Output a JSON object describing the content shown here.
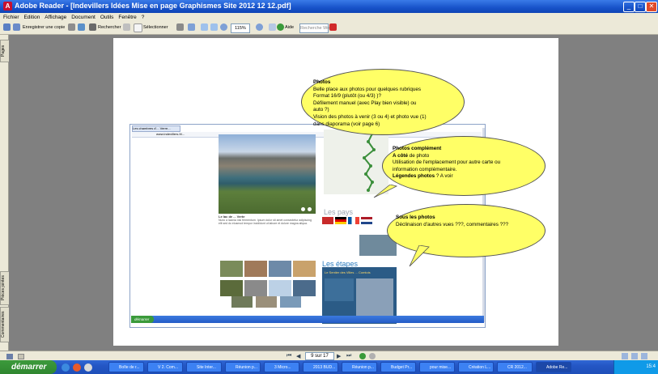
{
  "window": {
    "title": "Adobe Reader - [Indevillers Idées Mise en page Graphismes Site 2012 12 12.pdf]",
    "app_icon": "adobe-reader-icon",
    "controls": [
      "_",
      "□",
      "✕"
    ]
  },
  "menu": [
    "Fichier",
    "Edition",
    "Affichage",
    "Document",
    "Outils",
    "Fenêtre",
    "?"
  ],
  "toolbar": {
    "save_copy": "Enregistrer une copie",
    "search": "Rechercher",
    "select": "Sélectionner",
    "zoom": "115%",
    "help": "Aide",
    "search_web": "Recherche Web"
  },
  "left_tabs": {
    "pages": "Pages",
    "attachments": "Pièces jointes",
    "comments": "Commentaires"
  },
  "embedded": {
    "tab_title": "Les chambres d'... Verre...",
    "url": "www.indevillers.fr/...",
    "caption_title": "Le lac de ... Verte",
    "caption_text": "Nunc a lacinia nisi fermentum. Ipsum dolor sit amet consectetur adipiscing elit sed do eiusmod tempor incididunt ut labore et dolore magna aliqua.",
    "section_pays": "Les pays",
    "section_etapes": "Les étapes",
    "etapes_banner": "Le Sentier des Villes ... Comtois",
    "start": "démarrer"
  },
  "callouts": {
    "photos": {
      "title": "Photos",
      "lines": [
        "Belle place aux photos pour quelques rubriques",
        "Format 16/9 (plutôt (ou 4/3) )?",
        "Défilement manuel (avec Play bien visible) ou",
        "auto ?)",
        "Vision des photos à venir (3 ou 4) et photo vue (1)",
        "dans diaporama (voir page 6)"
      ]
    },
    "complement": {
      "title": "Photos complément",
      "line1_bold": "A côté",
      "line1_rest": " de photo",
      "line2": "Utilisation de l'emplacement pour autre carte ou",
      "line3": "information complémentaire.",
      "line4_bold": "Légendes photos",
      "line4_rest": " ? A voir"
    },
    "sous": {
      "title": "Sous les photos",
      "line1": "Déclinaison d'autres vues ???, commentaires ???"
    }
  },
  "status": {
    "page_indicator": "9 sur 17"
  },
  "taskbar": {
    "start": "démarrer",
    "tasks": [
      "Boîte de r...",
      "V 2. Com...",
      "Site Inter...",
      "Réunion p...",
      "3 Micro...",
      "2013 BUD...",
      "Réunion p...",
      "Budget Pr...",
      "pour mise...",
      "Création L...",
      "CR 2012...",
      "Adobe Re..."
    ],
    "clock": "15:4"
  },
  "colors": {
    "callout_fill": "#ffff66",
    "titlebar": "#1752c9",
    "taskbar": "#2456c4",
    "start_button": "#2f862f"
  }
}
